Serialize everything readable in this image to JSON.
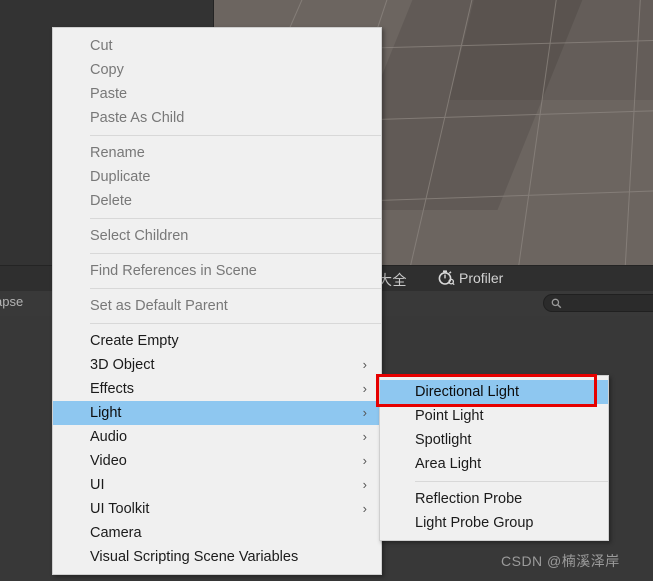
{
  "window": {
    "background_color": "#383838",
    "scene_color": "#6c6560",
    "accent_highlight": "#8ec7f0",
    "annotation_color": "#e60000"
  },
  "tabbar": {
    "clock_icon": "clock-icon",
    "cjk_tab_label": "大全",
    "profiler_icon": "stopwatch-icon",
    "profiler_label": "Profiler"
  },
  "toolbar": {
    "collapse_label": "ollapse",
    "search_icon": "search-icon",
    "search_value": "",
    "search_placeholder": ""
  },
  "context_menu": {
    "groups": [
      {
        "items": [
          {
            "label": "Cut",
            "disabled": true,
            "submenu": false
          },
          {
            "label": "Copy",
            "disabled": true,
            "submenu": false
          },
          {
            "label": "Paste",
            "disabled": true,
            "submenu": false
          },
          {
            "label": "Paste As Child",
            "disabled": true,
            "submenu": false
          }
        ]
      },
      {
        "items": [
          {
            "label": "Rename",
            "disabled": true,
            "submenu": false
          },
          {
            "label": "Duplicate",
            "disabled": true,
            "submenu": false
          },
          {
            "label": "Delete",
            "disabled": true,
            "submenu": false
          }
        ]
      },
      {
        "items": [
          {
            "label": "Select Children",
            "disabled": true,
            "submenu": false
          }
        ]
      },
      {
        "items": [
          {
            "label": "Find References in Scene",
            "disabled": true,
            "submenu": false
          }
        ]
      },
      {
        "items": [
          {
            "label": "Set as Default Parent",
            "disabled": true,
            "submenu": false
          }
        ]
      },
      {
        "items": [
          {
            "label": "Create Empty",
            "disabled": false,
            "submenu": false
          },
          {
            "label": "3D Object",
            "disabled": false,
            "submenu": true
          },
          {
            "label": "Effects",
            "disabled": false,
            "submenu": true
          },
          {
            "label": "Light",
            "disabled": false,
            "submenu": true,
            "selected": true
          },
          {
            "label": "Audio",
            "disabled": false,
            "submenu": true
          },
          {
            "label": "Video",
            "disabled": false,
            "submenu": true
          },
          {
            "label": "UI",
            "disabled": false,
            "submenu": true
          },
          {
            "label": "UI Toolkit",
            "disabled": false,
            "submenu": true
          },
          {
            "label": "Camera",
            "disabled": false,
            "submenu": false
          },
          {
            "label": "Visual Scripting Scene Variables",
            "disabled": false,
            "submenu": false
          }
        ]
      }
    ],
    "submenu_arrow": "chevron-right-icon"
  },
  "light_submenu": {
    "groups": [
      {
        "items": [
          {
            "label": "Directional Light",
            "selected": true
          },
          {
            "label": "Point Light",
            "selected": false
          },
          {
            "label": "Spotlight",
            "selected": false
          },
          {
            "label": "Area Light",
            "selected": false
          }
        ]
      },
      {
        "items": [
          {
            "label": "Reflection Probe",
            "selected": false
          },
          {
            "label": "Light Probe Group",
            "selected": false
          }
        ]
      }
    ]
  },
  "watermark": {
    "text": "CSDN @楠溪泽岸"
  }
}
